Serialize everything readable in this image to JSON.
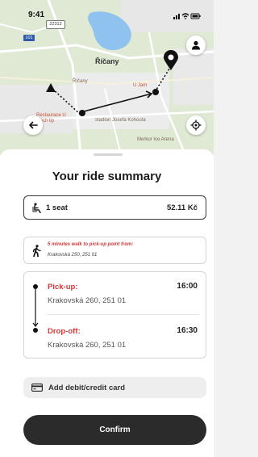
{
  "status_bar": {
    "time": "9:41",
    "plate": "22312"
  },
  "map": {
    "road_badge": "101",
    "town": "Říčany",
    "labels": {
      "ricany_small": "Říčany",
      "u_jam": "U Jam",
      "restaurace": "Restaurace U\nmých lip",
      "stadion": "stadion Josefa Kohouta",
      "merkur": "Merkur Ice Arena"
    }
  },
  "sheet": {
    "title": "Your ride summary",
    "seats": {
      "label": "1 seat",
      "price": "52.11 Kč"
    },
    "walk": {
      "title": "5 minutes walk to pick-up point from:",
      "address": "Krakovská 250, 251 01"
    },
    "pickup": {
      "label": "Pick-up:",
      "time": "16:00",
      "address": "Krakovská 260, 251 01"
    },
    "dropoff": {
      "label": "Drop-off:",
      "time": "16:30",
      "address": "Krakovská 260, 251 01"
    },
    "payment_label": "Add debit/credit card",
    "confirm_label": "Confirm"
  },
  "colors": {
    "accent_red": "#d23a3a",
    "button_dark": "#2b2b2b",
    "map_green": "#dfe9d3",
    "water": "#8fc2ee"
  },
  "icons": {
    "status": [
      "signal-icon",
      "wifi-icon",
      "battery-icon"
    ],
    "map": [
      "profile-icon",
      "back-icon",
      "locate-icon",
      "destination-pin-icon",
      "start-marker-icon"
    ],
    "sheet": [
      "seat-icon",
      "walking-icon",
      "card-icon"
    ]
  }
}
